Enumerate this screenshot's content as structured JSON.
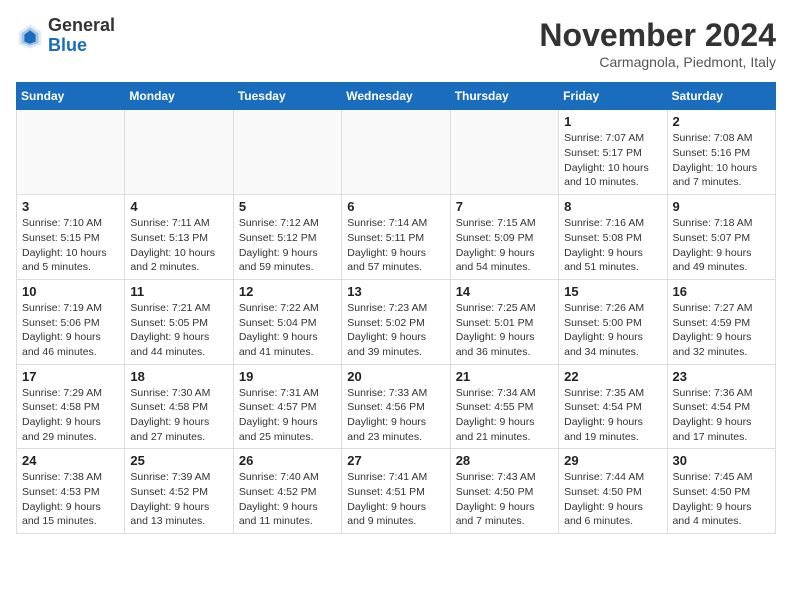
{
  "header": {
    "logo": {
      "general": "General",
      "blue": "Blue"
    },
    "title": "November 2024",
    "subtitle": "Carmagnola, Piedmont, Italy"
  },
  "calendar": {
    "headers": [
      "Sunday",
      "Monday",
      "Tuesday",
      "Wednesday",
      "Thursday",
      "Friday",
      "Saturday"
    ],
    "weeks": [
      [
        {
          "day": "",
          "info": ""
        },
        {
          "day": "",
          "info": ""
        },
        {
          "day": "",
          "info": ""
        },
        {
          "day": "",
          "info": ""
        },
        {
          "day": "",
          "info": ""
        },
        {
          "day": "1",
          "info": "Sunrise: 7:07 AM\nSunset: 5:17 PM\nDaylight: 10 hours and 10 minutes."
        },
        {
          "day": "2",
          "info": "Sunrise: 7:08 AM\nSunset: 5:16 PM\nDaylight: 10 hours and 7 minutes."
        }
      ],
      [
        {
          "day": "3",
          "info": "Sunrise: 7:10 AM\nSunset: 5:15 PM\nDaylight: 10 hours and 5 minutes."
        },
        {
          "day": "4",
          "info": "Sunrise: 7:11 AM\nSunset: 5:13 PM\nDaylight: 10 hours and 2 minutes."
        },
        {
          "day": "5",
          "info": "Sunrise: 7:12 AM\nSunset: 5:12 PM\nDaylight: 9 hours and 59 minutes."
        },
        {
          "day": "6",
          "info": "Sunrise: 7:14 AM\nSunset: 5:11 PM\nDaylight: 9 hours and 57 minutes."
        },
        {
          "day": "7",
          "info": "Sunrise: 7:15 AM\nSunset: 5:09 PM\nDaylight: 9 hours and 54 minutes."
        },
        {
          "day": "8",
          "info": "Sunrise: 7:16 AM\nSunset: 5:08 PM\nDaylight: 9 hours and 51 minutes."
        },
        {
          "day": "9",
          "info": "Sunrise: 7:18 AM\nSunset: 5:07 PM\nDaylight: 9 hours and 49 minutes."
        }
      ],
      [
        {
          "day": "10",
          "info": "Sunrise: 7:19 AM\nSunset: 5:06 PM\nDaylight: 9 hours and 46 minutes."
        },
        {
          "day": "11",
          "info": "Sunrise: 7:21 AM\nSunset: 5:05 PM\nDaylight: 9 hours and 44 minutes."
        },
        {
          "day": "12",
          "info": "Sunrise: 7:22 AM\nSunset: 5:04 PM\nDaylight: 9 hours and 41 minutes."
        },
        {
          "day": "13",
          "info": "Sunrise: 7:23 AM\nSunset: 5:02 PM\nDaylight: 9 hours and 39 minutes."
        },
        {
          "day": "14",
          "info": "Sunrise: 7:25 AM\nSunset: 5:01 PM\nDaylight: 9 hours and 36 minutes."
        },
        {
          "day": "15",
          "info": "Sunrise: 7:26 AM\nSunset: 5:00 PM\nDaylight: 9 hours and 34 minutes."
        },
        {
          "day": "16",
          "info": "Sunrise: 7:27 AM\nSunset: 4:59 PM\nDaylight: 9 hours and 32 minutes."
        }
      ],
      [
        {
          "day": "17",
          "info": "Sunrise: 7:29 AM\nSunset: 4:58 PM\nDaylight: 9 hours and 29 minutes."
        },
        {
          "day": "18",
          "info": "Sunrise: 7:30 AM\nSunset: 4:58 PM\nDaylight: 9 hours and 27 minutes."
        },
        {
          "day": "19",
          "info": "Sunrise: 7:31 AM\nSunset: 4:57 PM\nDaylight: 9 hours and 25 minutes."
        },
        {
          "day": "20",
          "info": "Sunrise: 7:33 AM\nSunset: 4:56 PM\nDaylight: 9 hours and 23 minutes."
        },
        {
          "day": "21",
          "info": "Sunrise: 7:34 AM\nSunset: 4:55 PM\nDaylight: 9 hours and 21 minutes."
        },
        {
          "day": "22",
          "info": "Sunrise: 7:35 AM\nSunset: 4:54 PM\nDaylight: 9 hours and 19 minutes."
        },
        {
          "day": "23",
          "info": "Sunrise: 7:36 AM\nSunset: 4:54 PM\nDaylight: 9 hours and 17 minutes."
        }
      ],
      [
        {
          "day": "24",
          "info": "Sunrise: 7:38 AM\nSunset: 4:53 PM\nDaylight: 9 hours and 15 minutes."
        },
        {
          "day": "25",
          "info": "Sunrise: 7:39 AM\nSunset: 4:52 PM\nDaylight: 9 hours and 13 minutes."
        },
        {
          "day": "26",
          "info": "Sunrise: 7:40 AM\nSunset: 4:52 PM\nDaylight: 9 hours and 11 minutes."
        },
        {
          "day": "27",
          "info": "Sunrise: 7:41 AM\nSunset: 4:51 PM\nDaylight: 9 hours and 9 minutes."
        },
        {
          "day": "28",
          "info": "Sunrise: 7:43 AM\nSunset: 4:50 PM\nDaylight: 9 hours and 7 minutes."
        },
        {
          "day": "29",
          "info": "Sunrise: 7:44 AM\nSunset: 4:50 PM\nDaylight: 9 hours and 6 minutes."
        },
        {
          "day": "30",
          "info": "Sunrise: 7:45 AM\nSunset: 4:50 PM\nDaylight: 9 hours and 4 minutes."
        }
      ]
    ]
  }
}
